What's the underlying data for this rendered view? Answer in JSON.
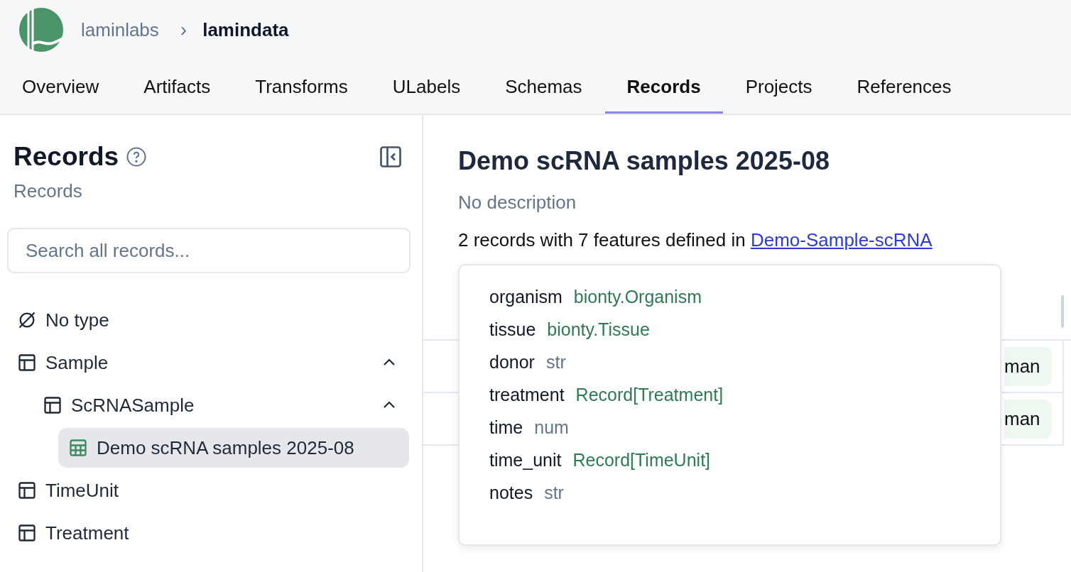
{
  "breadcrumb": {
    "org": "laminlabs",
    "separator": "›",
    "instance": "lamindata"
  },
  "tabs": [
    {
      "label": "Overview",
      "selected": false
    },
    {
      "label": "Artifacts",
      "selected": false
    },
    {
      "label": "Transforms",
      "selected": false
    },
    {
      "label": "ULabels",
      "selected": false
    },
    {
      "label": "Schemas",
      "selected": false
    },
    {
      "label": "Records",
      "selected": true
    },
    {
      "label": "Projects",
      "selected": false
    },
    {
      "label": "References",
      "selected": false
    }
  ],
  "sidebar": {
    "title": "Records",
    "subtitle": "Records",
    "search": {
      "placeholder": "Search all records..."
    },
    "items": [
      {
        "label": "No type",
        "kind": "none",
        "selected": false
      },
      {
        "label": "Sample",
        "kind": "type",
        "selected": false,
        "expanded": true,
        "children": [
          {
            "label": "ScRNASample",
            "kind": "type",
            "selected": false,
            "expanded": true,
            "children": [
              {
                "label": "Demo scRNA samples 2025-08",
                "kind": "sheet",
                "selected": true
              }
            ]
          }
        ]
      },
      {
        "label": "TimeUnit",
        "kind": "type",
        "selected": false
      },
      {
        "label": "Treatment",
        "kind": "type",
        "selected": false
      }
    ]
  },
  "main": {
    "title": "Demo scRNA samples 2025-08",
    "description": "No description",
    "summary": {
      "text": "2 records with 7 features defined in",
      "link": "Demo-Sample-scRNA"
    },
    "table": {
      "rows": [
        {
          "column_1": "man"
        },
        {
          "column_1": "man"
        }
      ]
    },
    "features": [
      {
        "name": "organism",
        "type": "bionty.Organism",
        "kind": "registry"
      },
      {
        "name": "tissue",
        "type": "bionty.Tissue",
        "kind": "registry"
      },
      {
        "name": "donor",
        "type": "str",
        "kind": "primitive"
      },
      {
        "name": "treatment",
        "type": "Record[Treatment]",
        "kind": "registry"
      },
      {
        "name": "time",
        "type": "num",
        "kind": "primitive"
      },
      {
        "name": "time_unit",
        "type": "Record[TimeUnit]",
        "kind": "registry"
      },
      {
        "name": "notes",
        "type": "str",
        "kind": "primitive"
      }
    ]
  }
}
